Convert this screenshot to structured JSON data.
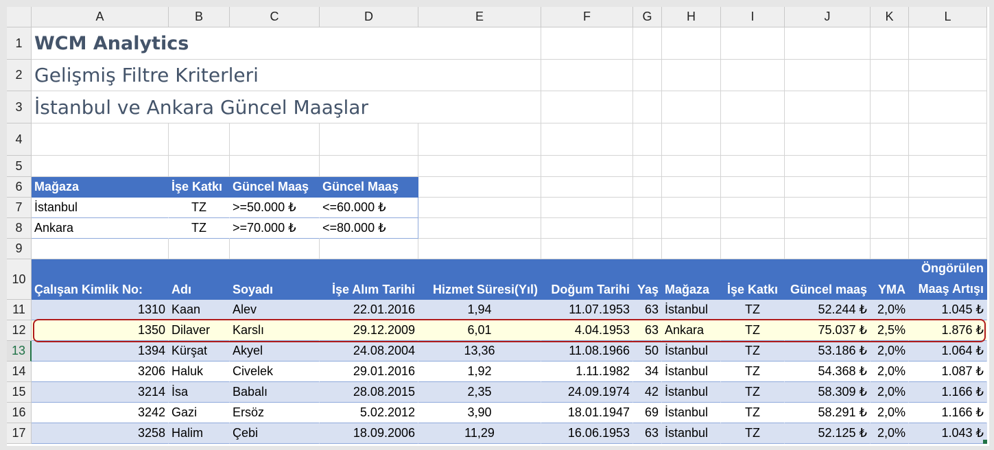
{
  "columns": [
    "A",
    "B",
    "C",
    "D",
    "E",
    "F",
    "G",
    "H",
    "I",
    "J",
    "K",
    "L"
  ],
  "rows": [
    "1",
    "2",
    "3",
    "4",
    "5",
    "6",
    "7",
    "8",
    "9",
    "10",
    "11",
    "12",
    "13",
    "14",
    "15",
    "16",
    "17"
  ],
  "active_row": "13",
  "title": "WCM Analytics",
  "subtitle1": "Gelişmiş Filtre Kriterleri",
  "subtitle2": "İstanbul ve Ankara Güncel Maaşlar",
  "criteria": {
    "headers": [
      "Mağaza",
      "İşe Katkı",
      "Güncel Maaş",
      "Güncel Maaş"
    ],
    "rows": [
      [
        "İstanbul",
        "TZ",
        ">=50.000 ₺",
        "<=60.000 ₺"
      ],
      [
        "Ankara",
        "TZ",
        ">=70.000 ₺",
        "<=80.000 ₺"
      ]
    ]
  },
  "table": {
    "headers": [
      "Çalışan Kimlik No:",
      "Adı",
      "Soyadı",
      "İşe Alım Tarihi",
      "Hizmet Süresi(Yıl)",
      "Doğum Tarihi",
      "Yaş",
      "Mağaza",
      "İşe Katkı",
      "Güncel maaş",
      "YMA",
      "Öngörülen",
      "Maaş Artışı"
    ],
    "rows": [
      [
        "1310",
        "Kaan",
        "Alev",
        "22.01.2016",
        "1,94",
        "11.07.1953",
        "63",
        "İstanbul",
        "TZ",
        "52.244 ₺",
        "2,0%",
        "1.045 ₺"
      ],
      [
        "1350",
        "Dilaver",
        "Karslı",
        "29.12.2009",
        "6,01",
        "4.04.1953",
        "63",
        "Ankara",
        "TZ",
        "75.037 ₺",
        "2,5%",
        "1.876 ₺"
      ],
      [
        "1394",
        "Kürşat",
        "Akyel",
        "24.08.2004",
        "13,36",
        "11.08.1966",
        "50",
        "İstanbul",
        "TZ",
        "53.186 ₺",
        "2,0%",
        "1.064 ₺"
      ],
      [
        "3206",
        "Haluk",
        "Civelek",
        "29.01.2016",
        "1,92",
        "1.11.1982",
        "34",
        "İstanbul",
        "TZ",
        "54.368 ₺",
        "2,0%",
        "1.087 ₺"
      ],
      [
        "3214",
        "İsa",
        "Babalı",
        "28.08.2015",
        "2,35",
        "24.09.1974",
        "42",
        "İstanbul",
        "TZ",
        "58.309 ₺",
        "2,0%",
        "1.166 ₺"
      ],
      [
        "3242",
        "Gazi",
        "Ersöz",
        "5.02.2012",
        "3,90",
        "18.01.1947",
        "69",
        "İstanbul",
        "TZ",
        "58.291 ₺",
        "2,0%",
        "1.166 ₺"
      ],
      [
        "3258",
        "Halim",
        "Çebi",
        "18.09.2006",
        "11,29",
        "16.06.1953",
        "63",
        "İstanbul",
        "TZ",
        "52.125 ₺",
        "2,0%",
        "1.043 ₺"
      ]
    ],
    "highlighted_row_index": 1
  },
  "colors": {
    "header_blue": "#4472c4",
    "band_blue": "#d9e1f2",
    "highlight_fill": "#ffffe1",
    "highlight_border": "#b01b1b",
    "title_text": "#44546a"
  }
}
